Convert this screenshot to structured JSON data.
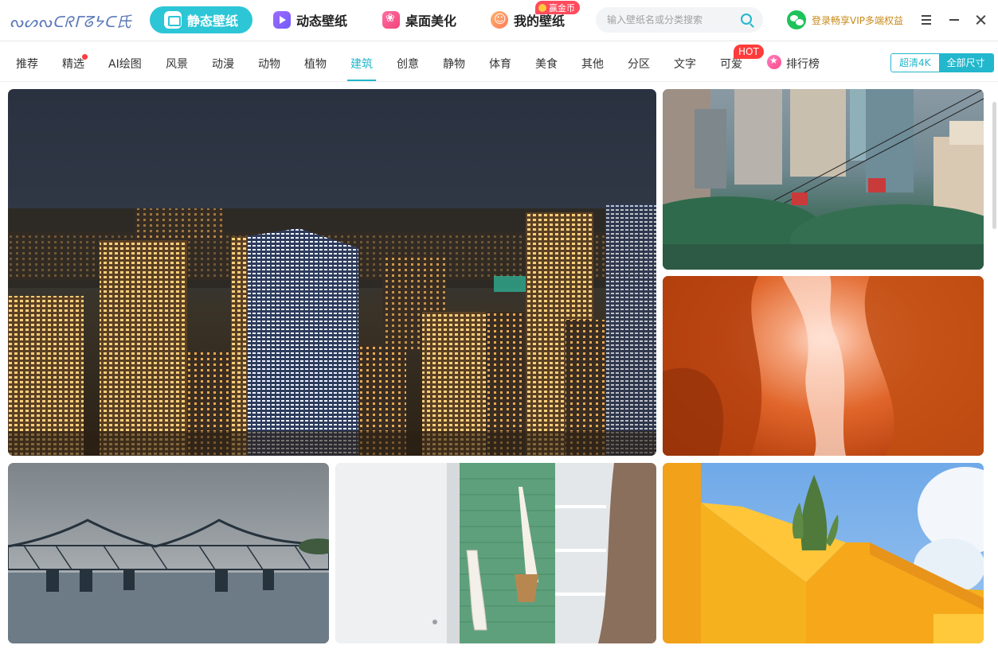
{
  "app": {
    "logo_text": "ᔓᔕᔓᑕᖇᒥᘔᔭᑕ氏"
  },
  "main_tabs": [
    {
      "label": "静态壁纸",
      "icon": "static-wallpaper-icon",
      "active": true
    },
    {
      "label": "动态壁纸",
      "icon": "dynamic-wallpaper-icon",
      "active": false
    },
    {
      "label": "桌面美化",
      "icon": "desktop-beautify-icon",
      "active": false
    },
    {
      "label": "我的壁纸",
      "icon": "my-wallpaper-icon",
      "active": false
    }
  ],
  "coin_badge": "赢金币",
  "search": {
    "placeholder": "输入壁纸名或分类搜索"
  },
  "login": {
    "text": "登录畅享VIP多端权益"
  },
  "categories": [
    {
      "label": "推荐"
    },
    {
      "label": "精选",
      "dot": true
    },
    {
      "label": "AI绘图"
    },
    {
      "label": "风景"
    },
    {
      "label": "动漫"
    },
    {
      "label": "动物"
    },
    {
      "label": "植物"
    },
    {
      "label": "建筑",
      "active": true
    },
    {
      "label": "创意"
    },
    {
      "label": "静物"
    },
    {
      "label": "体育"
    },
    {
      "label": "美食"
    },
    {
      "label": "其他"
    },
    {
      "label": "分区"
    },
    {
      "label": "文字"
    },
    {
      "label": "可爱"
    },
    {
      "label": "排行榜"
    }
  ],
  "hot_badge": "HOT",
  "size_filter": {
    "option_4k": "超清4K",
    "option_all": "全部尺寸",
    "selected": "全部尺寸"
  },
  "colors": {
    "accent": "#22b7cc",
    "tab_active_bg": "#2cc6d6",
    "badge_red": "#ff3b3b",
    "vip_gold": "#c88a1a"
  },
  "wallpapers": [
    {
      "name": "night-city-skyline"
    },
    {
      "name": "cable-car-city"
    },
    {
      "name": "antelope-canyon"
    },
    {
      "name": "steel-bridge-river"
    },
    {
      "name": "green-wall-bags"
    },
    {
      "name": "yellow-building-cactus"
    }
  ]
}
